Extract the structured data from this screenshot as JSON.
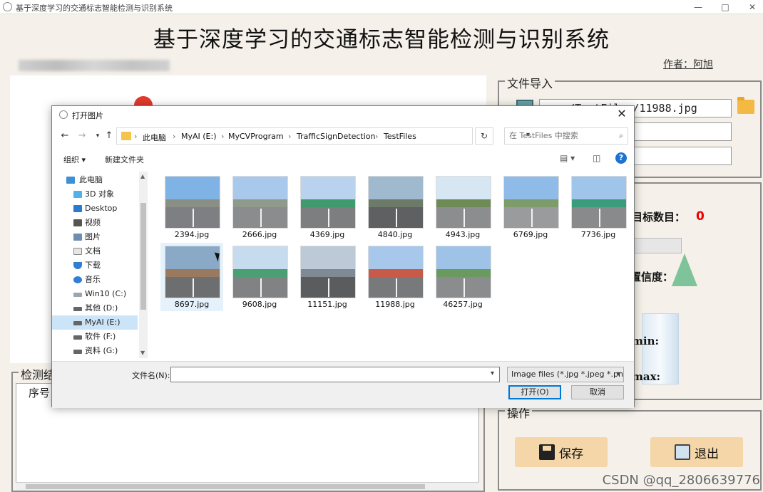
{
  "main_window": {
    "title": "基于深度学习的交通标志智能检测与识别系统",
    "heading": "基于深度学习的交通标志智能检测与识别系统",
    "author": "作者：阿旭",
    "file_import": {
      "group_title": "文件导入",
      "path_value": "..../TestFiles/11988.jpg"
    },
    "stats": {
      "target_count_label": "目标数目：",
      "target_count_value": "0",
      "confidence_label": "置信度：",
      "xmin_label": "min:",
      "ymax_label": "max:"
    },
    "results": {
      "group_title": "检测结果",
      "column_index": "序号"
    },
    "actions": {
      "group_title": "操作",
      "save_label": "保存",
      "exit_label": "退出"
    },
    "watermark": "CSDN @qq_2806639776"
  },
  "dialog": {
    "title": "打开图片",
    "close": "✕",
    "breadcrumb": [
      "此电脑",
      "MyAI (E:)",
      "MyCVProgram",
      "TrafficSignDetection",
      "TestFiles"
    ],
    "search_placeholder": "在 TestFiles 中搜索",
    "toolbar": {
      "organize": "组织 ▾",
      "new_folder": "新建文件夹"
    },
    "nav_items": [
      {
        "label": "此电脑",
        "icon": "computer-icon"
      },
      {
        "label": "3D 对象",
        "icon": "3d-objects-icon"
      },
      {
        "label": "Desktop",
        "icon": "desktop-icon"
      },
      {
        "label": "视频",
        "icon": "video-icon"
      },
      {
        "label": "图片",
        "icon": "pictures-icon"
      },
      {
        "label": "文档",
        "icon": "documents-icon"
      },
      {
        "label": "下载",
        "icon": "download-icon"
      },
      {
        "label": "音乐",
        "icon": "music-icon"
      },
      {
        "label": "Win10 (C:)",
        "icon": "drive-icon"
      },
      {
        "label": "其他 (D:)",
        "icon": "drive-icon"
      },
      {
        "label": "MyAI (E:)",
        "icon": "drive-icon"
      },
      {
        "label": "软件 (F:)",
        "icon": "drive-icon"
      },
      {
        "label": "资料 (G:)",
        "icon": "drive-icon"
      }
    ],
    "files": [
      {
        "name": "2394.jpg",
        "sky": "#7fb3e6",
        "mid": "#8a8f86",
        "road": "#7d7f82"
      },
      {
        "name": "2666.jpg",
        "sky": "#a9c9ec",
        "mid": "#8f9a8c",
        "road": "#8a8c8e"
      },
      {
        "name": "4369.jpg",
        "sky": "#b9d3ee",
        "mid": "#3f9a6e",
        "road": "#7c7e80"
      },
      {
        "name": "4840.jpg",
        "sky": "#9fb9cf",
        "mid": "#6d7a6a",
        "road": "#5e6062"
      },
      {
        "name": "4943.jpg",
        "sky": "#d7e6f3",
        "mid": "#6e8a55",
        "road": "#8c8d8f"
      },
      {
        "name": "6769.jpg",
        "sky": "#8fbbe8",
        "mid": "#7d9c6a",
        "road": "#9a9b9d"
      },
      {
        "name": "7736.jpg",
        "sky": "#9fc6ea",
        "mid": "#3a9c7a",
        "road": "#888a8c"
      },
      {
        "name": "8697.jpg",
        "sky": "#8aa9c7",
        "mid": "#9a7a5e",
        "road": "#6d6e70"
      },
      {
        "name": "9608.jpg",
        "sky": "#c7dbef",
        "mid": "#4a9f73",
        "road": "#808284"
      },
      {
        "name": "11151.jpg",
        "sky": "#bcc9d6",
        "mid": "#7f8a94",
        "road": "#5b5c5e"
      },
      {
        "name": "11988.jpg",
        "sky": "#a7c8ea",
        "mid": "#c85a4a",
        "road": "#78797b"
      },
      {
        "name": "46257.jpg",
        "sky": "#9fc3e7",
        "mid": "#6a9a60",
        "road": "#8b8c8e"
      }
    ],
    "filename_label": "文件名(N):",
    "filename_value": "",
    "filter_value": "Image files (*.jpg *.jpeg *.pn",
    "open_label": "打开(O)",
    "cancel_label": "取消"
  }
}
